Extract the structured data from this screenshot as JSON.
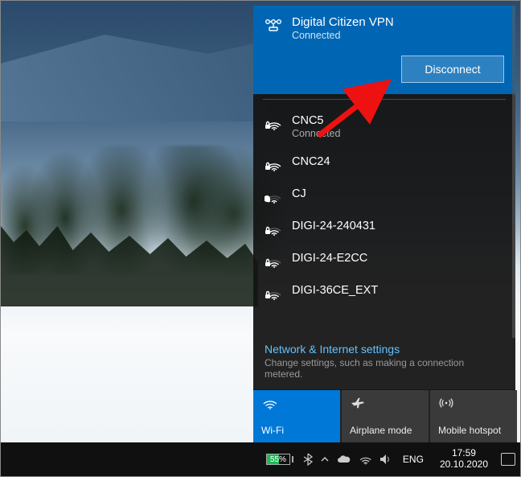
{
  "vpn": {
    "name": "Digital Citizen VPN",
    "status": "Connected",
    "disconnect_label": "Disconnect"
  },
  "networks": [
    {
      "name": "CNC5",
      "status": "Connected",
      "secured": true,
      "signal": 4
    },
    {
      "name": "CNC24",
      "status": "",
      "secured": true,
      "signal": 4
    },
    {
      "name": "CJ",
      "status": "",
      "secured": false,
      "signal": 1
    },
    {
      "name": "DIGI-24-240431",
      "status": "",
      "secured": true,
      "signal": 3
    },
    {
      "name": "DIGI-24-E2CC",
      "status": "",
      "secured": true,
      "signal": 3
    },
    {
      "name": "DIGI-36CE_EXT",
      "status": "",
      "secured": true,
      "signal": 3
    }
  ],
  "settings": {
    "title": "Network & Internet settings",
    "subtitle": "Change settings, such as making a connection metered."
  },
  "quick_actions": {
    "wifi": "Wi-Fi",
    "airplane": "Airplane mode",
    "hotspot": "Mobile hotspot"
  },
  "tray": {
    "battery_percent": "55%",
    "language": "ENG",
    "time": "17:59",
    "date": "20.10.2020"
  }
}
